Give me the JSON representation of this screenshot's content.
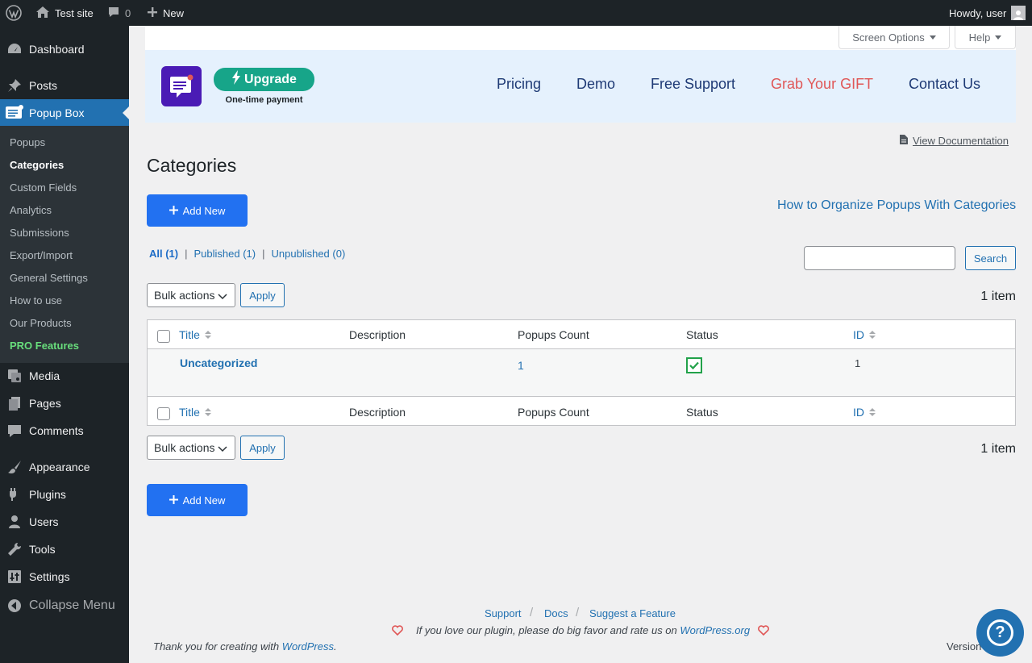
{
  "admin_bar": {
    "site_name": "Test site",
    "comments_count": "0",
    "new_label": "New",
    "howdy": "Howdy, user"
  },
  "sidebar": {
    "dashboard": "Dashboard",
    "posts": "Posts",
    "popup_box": "Popup Box",
    "submenu": [
      "Popups",
      "Categories",
      "Custom Fields",
      "Analytics",
      "Submissions",
      "Export/Import",
      "General Settings",
      "How to use",
      "Our Products",
      "PRO Features"
    ],
    "media": "Media",
    "pages": "Pages",
    "comments": "Comments",
    "appearance": "Appearance",
    "plugins": "Plugins",
    "users": "Users",
    "tools": "Tools",
    "settings": "Settings",
    "collapse": "Collapse Menu"
  },
  "screen_options": {
    "screen_options_label": "Screen Options",
    "help_label": "Help"
  },
  "promo": {
    "upgrade_label": "Upgrade",
    "one_time": "One-time payment",
    "links": [
      "Pricing",
      "Demo",
      "Free Support",
      "Grab Your GIFT",
      "Contact Us"
    ],
    "gift_color": "#e05757"
  },
  "doc_link": "View Documentation",
  "page_title": "Categories",
  "add_new_label": "Add New",
  "how_to_link": "How to Organize Popups With Categories",
  "filters": {
    "all": "All (1)",
    "published": "Published (1)",
    "unpublished": "Unpublished (0)",
    "sep": "|"
  },
  "search": {
    "button": "Search",
    "value": ""
  },
  "bulk": {
    "selected": "Bulk actions",
    "apply": "Apply"
  },
  "item_count": "1 item",
  "table": {
    "columns": [
      "Title",
      "Description",
      "Popups Count",
      "Status",
      "ID"
    ],
    "rows": [
      {
        "title": "Uncategorized",
        "description": "",
        "popups_count": "1",
        "status": "checked",
        "id": "1"
      }
    ]
  },
  "footer": {
    "support": "Support",
    "docs": "Docs",
    "suggest": "Suggest a Feature",
    "sep": "/",
    "love_text": "If you love our plugin, please do big favor and rate us on",
    "wp_org": "WordPress.org",
    "thanks": "Thank you for creating with",
    "wordpress": "WordPress",
    "period": ".",
    "version": "Version"
  },
  "help_fab": "?"
}
